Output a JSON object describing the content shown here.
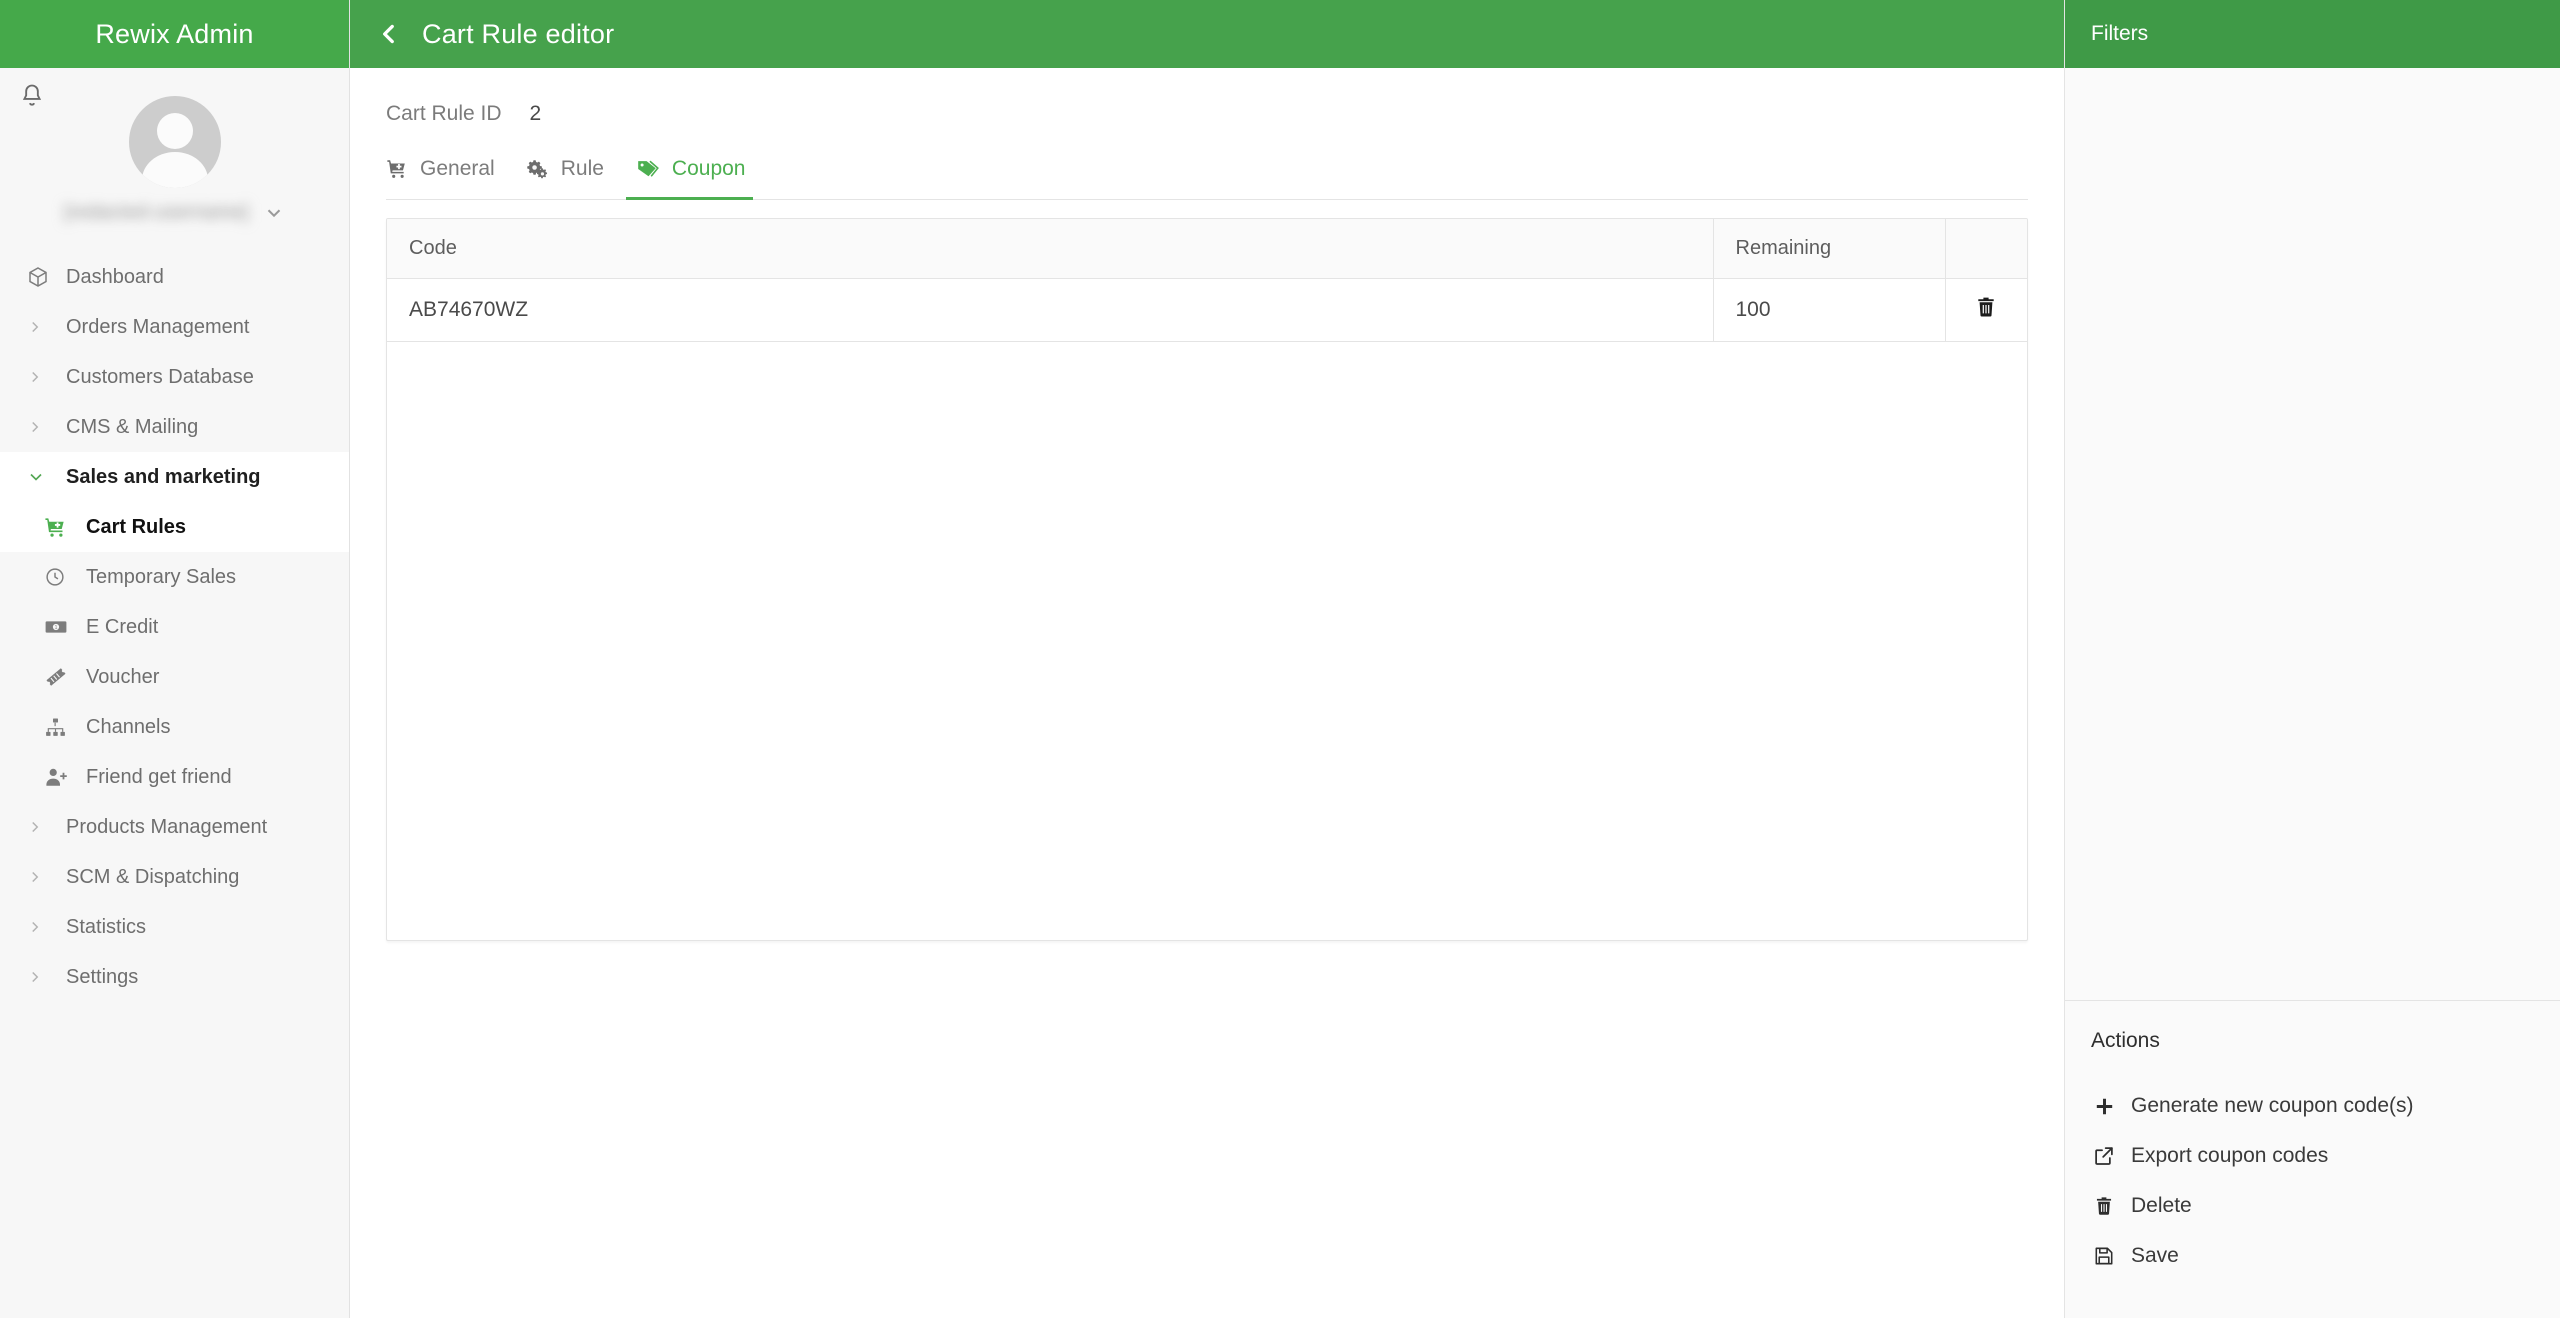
{
  "brand": {
    "title": "Rewix Admin"
  },
  "user": {
    "name": "[redacted-username]",
    "caret_icon": "chevron-down-icon",
    "bell_icon": "bell-icon",
    "avatar_icon": "avatar"
  },
  "sidebar": {
    "items": [
      {
        "label": "Dashboard",
        "icon": "cube-icon",
        "type": "link"
      },
      {
        "label": "Orders Management",
        "icon": "chevron-right-icon",
        "type": "section"
      },
      {
        "label": "Customers Database",
        "icon": "chevron-right-icon",
        "type": "section"
      },
      {
        "label": "CMS & Mailing",
        "icon": "chevron-right-icon",
        "type": "section"
      },
      {
        "label": "Sales and marketing",
        "icon": "chevron-down-icon",
        "type": "section",
        "open": true
      },
      {
        "label": "Products Management",
        "icon": "chevron-right-icon",
        "type": "section"
      },
      {
        "label": "SCM & Dispatching",
        "icon": "chevron-right-icon",
        "type": "section"
      },
      {
        "label": "Statistics",
        "icon": "chevron-right-icon",
        "type": "section"
      },
      {
        "label": "Settings",
        "icon": "chevron-right-icon",
        "type": "section"
      }
    ],
    "sales_submenu": [
      {
        "label": "Cart Rules",
        "icon": "cart-plus-icon",
        "active": true
      },
      {
        "label": "Temporary Sales",
        "icon": "clock-icon",
        "active": false
      },
      {
        "label": "E Credit",
        "icon": "money-bill-icon",
        "active": false
      },
      {
        "label": "Voucher",
        "icon": "ticket-icon",
        "active": false
      },
      {
        "label": "Channels",
        "icon": "sitemap-icon",
        "active": false
      },
      {
        "label": "Friend get friend",
        "icon": "user-plus-icon",
        "active": false
      }
    ]
  },
  "topbar": {
    "back_icon": "chevron-left-icon",
    "title": "Cart Rule editor"
  },
  "page": {
    "id_label": "Cart Rule ID",
    "id_value": "2",
    "tabs": [
      {
        "label": "General",
        "icon": "cart-plus-icon",
        "active": false
      },
      {
        "label": "Rule",
        "icon": "cogs-icon",
        "active": false
      },
      {
        "label": "Coupon",
        "icon": "tags-icon",
        "active": true
      }
    ]
  },
  "table": {
    "columns": [
      "Code",
      "Remaining",
      ""
    ],
    "rows": [
      {
        "code": "AB74670WZ",
        "remaining": "100",
        "delete_icon": "trash-icon"
      }
    ]
  },
  "right_panel": {
    "filters_title": "Filters",
    "actions_title": "Actions",
    "actions": [
      {
        "label": "Generate new coupon code(s)",
        "icon": "plus-icon"
      },
      {
        "label": "Export coupon codes",
        "icon": "external-link-icon"
      },
      {
        "label": "Delete",
        "icon": "trash-icon"
      },
      {
        "label": "Save",
        "icon": "floppy-disk-icon"
      }
    ]
  },
  "colors": {
    "brand_green": "#45a94a",
    "topbar_green": "#46a24c",
    "filters_green": "#3f9a47",
    "accent_green": "#4caf50",
    "sidebar_bg": "#f7f7f7",
    "panel_border": "#e4e4e4"
  }
}
